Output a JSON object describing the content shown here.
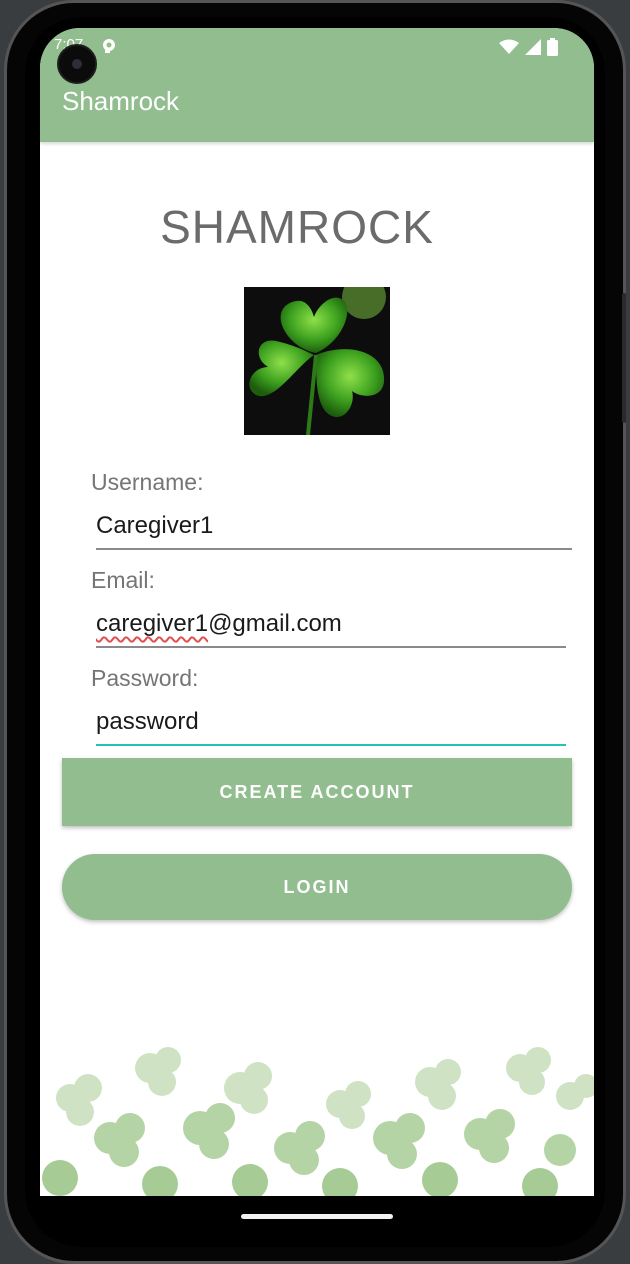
{
  "status": {
    "time": "7:07"
  },
  "app": {
    "title": "Shamrock"
  },
  "main": {
    "heading": "SHAMROCK",
    "username_label": "Username:",
    "username_value": "Caregiver1",
    "email_label": "Email:",
    "email_value_part1": "caregiver1",
    "email_value_part2": "@gmail.com",
    "password_label": "Password:",
    "password_value": "password",
    "create_button": "CREATE ACCOUNT",
    "login_button": "LOGIN"
  },
  "colors": {
    "accent": "#91bd8f",
    "focus_underline": "#26c2b6",
    "heading_text": "#6b6b6b"
  },
  "icons": [
    "wifi-icon",
    "cellular-icon",
    "battery-icon",
    "notification-icon",
    "camera-cutout-icon",
    "shamrock-logo-icon"
  ]
}
